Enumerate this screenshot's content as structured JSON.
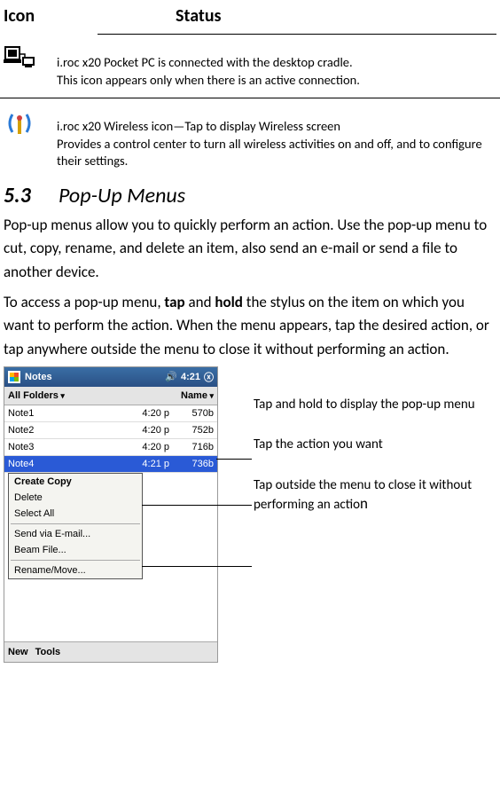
{
  "headers": {
    "icon": "Icon",
    "status": "Status"
  },
  "rows": [
    {
      "icon": "sync-cradle-icon",
      "lines": [
        "i.roc x20 Pocket PC is connected with the desktop cradle.",
        "This icon appears only when there is an active connection."
      ]
    },
    {
      "icon": "wireless-icon",
      "lines": [
        "i.roc x20 Wireless icon—Tap to display Wireless screen",
        "Provides a control center to turn all wireless activities on and off, and to configure their settings."
      ]
    }
  ],
  "section": {
    "num": "5.3",
    "title": "Pop-Up Menus"
  },
  "paras": [
    {
      "pre": "Pop-up menus allow you to quickly perform an action. Use the pop-up menu to cut, copy, rename, and delete an item, also send an e-mail or send a file to another device."
    },
    {
      "t1": "To access a pop-up menu, ",
      "b1": "tap",
      "t2": " and ",
      "b2": "hold",
      "t3": " the stylus on the item on which you want to perform the action. When the menu appears, tap the desired action, or tap anywhere outside the menu to close it without performing an action."
    }
  ],
  "pda": {
    "app": "Notes",
    "time": "4:21",
    "folders": "All Folders",
    "sort": "Name",
    "items": [
      {
        "name": "Note1",
        "time": "4:20 p",
        "size": "570b"
      },
      {
        "name": "Note2",
        "time": "4:20 p",
        "size": "752b"
      },
      {
        "name": "Note3",
        "time": "4:20 p",
        "size": "716b"
      },
      {
        "name": "Note4",
        "time": "4:21 p",
        "size": "736b"
      }
    ],
    "menu": {
      "createCopy": "Create Copy",
      "delete": "Delete",
      "selectAll": "Select All",
      "sendEmail": "Send via E-mail...",
      "beam": "Beam File...",
      "rename": "Rename/Move..."
    },
    "bottom": {
      "new": "New",
      "tools": "Tools"
    }
  },
  "callouts": {
    "c1": "Tap and hold to display the pop-up menu",
    "c2": " Tap the action you want",
    "c3a": "Tap outside the menu to close it without performing an actio",
    "c3b": "n"
  }
}
